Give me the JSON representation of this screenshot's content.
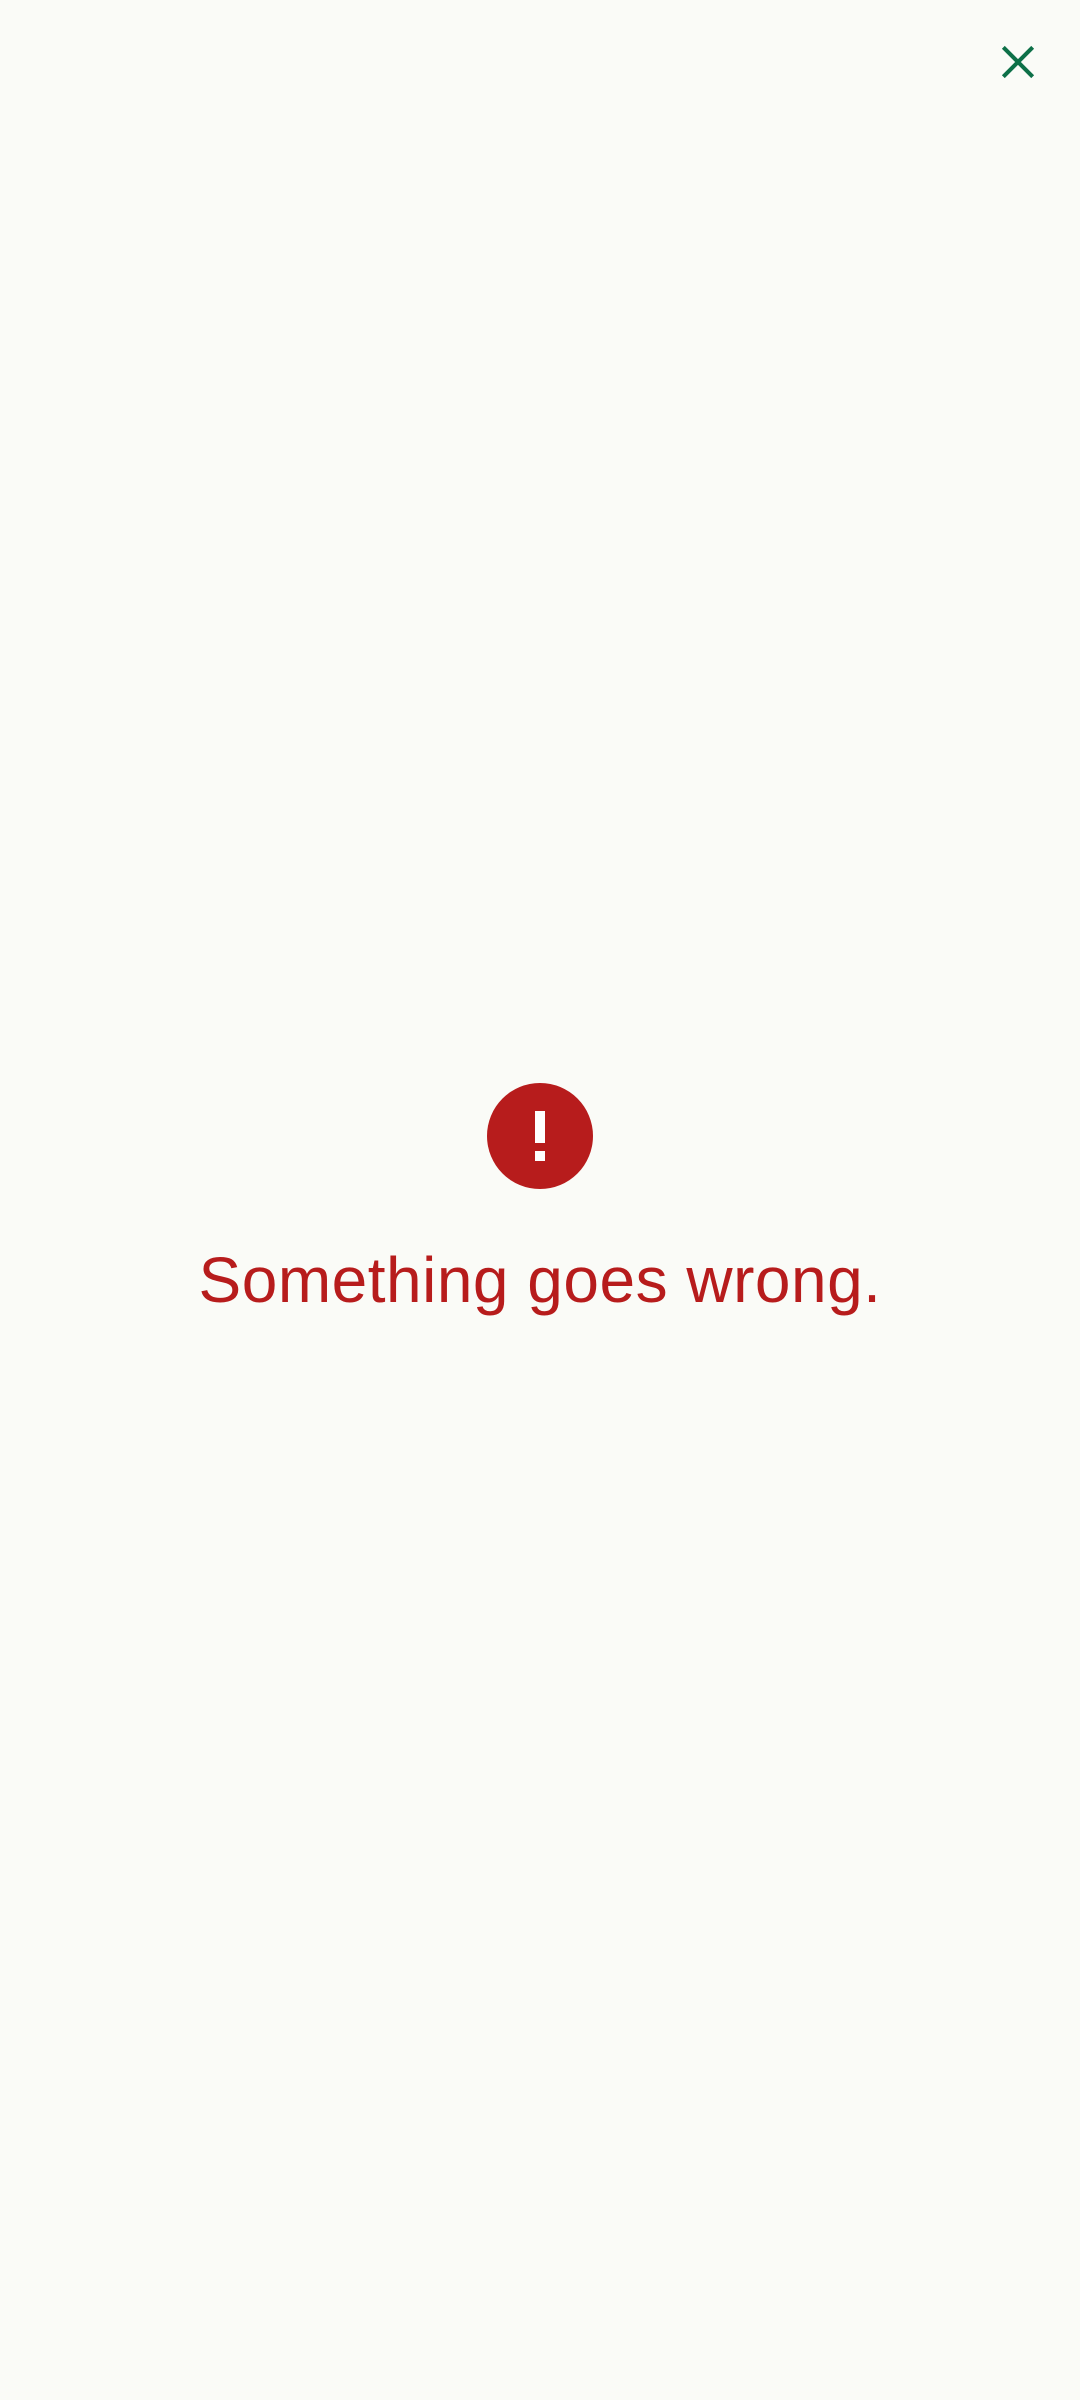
{
  "header": {
    "close_icon": "close-icon"
  },
  "error": {
    "icon": "exclamation-circle-icon",
    "message": "Something goes wrong."
  },
  "colors": {
    "background": "#fafbf7",
    "accent": "#0d7048",
    "error": "#b71c1c",
    "error_icon_glyph": "#ffffff"
  }
}
